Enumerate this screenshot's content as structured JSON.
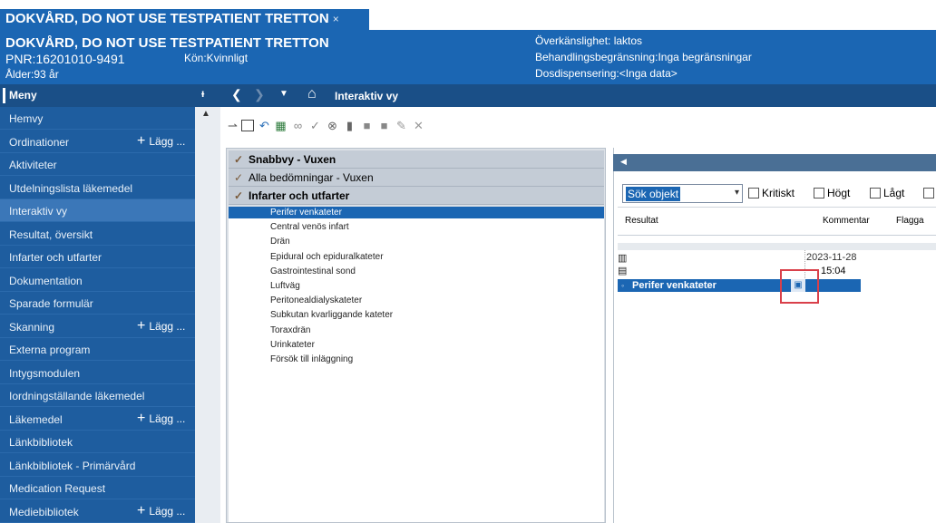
{
  "window": {
    "tab_title": "DOKVÅRD, DO NOT USE TESTPATIENT TRETTON",
    "tab_close": "×"
  },
  "patient": {
    "name": "DOKVÅRD, DO NOT USE TESTPATIENT TRETTON",
    "pnr": "PNR:16201010-9491",
    "sex": "Kön:Kvinnligt",
    "age": "Ålder:93 år",
    "alerts": [
      "Överkänslighet: laktos",
      "Behandlingsbegränsning:Inga begränsningar",
      "Dosdispensering:<Inga data>"
    ]
  },
  "menu": {
    "title": "Meny",
    "pin": "ᵻ",
    "items": [
      {
        "label": "Hemvy",
        "add": ""
      },
      {
        "label": "Ordinationer",
        "add": "Lägg ..."
      },
      {
        "label": "Aktiviteter",
        "add": ""
      },
      {
        "label": "Utdelningslista läkemedel",
        "add": ""
      },
      {
        "label": "Interaktiv vy",
        "add": "",
        "active": true
      },
      {
        "label": "Resultat, översikt",
        "add": ""
      },
      {
        "label": "Infarter och utfarter",
        "add": ""
      },
      {
        "label": "Dokumentation",
        "add": ""
      },
      {
        "label": "Sparade formulär",
        "add": ""
      },
      {
        "label": "Skanning",
        "add": "Lägg ..."
      },
      {
        "label": "Externa program",
        "add": ""
      },
      {
        "label": "Intygsmodulen",
        "add": ""
      },
      {
        "label": "Iordningställande läkemedel",
        "add": ""
      },
      {
        "label": "Läkemedel",
        "add": "Lägg ..."
      },
      {
        "label": "Länkbibliotek",
        "add": ""
      },
      {
        "label": "Länkbibliotek - Primärvård",
        "add": ""
      },
      {
        "label": "Medication Request",
        "add": ""
      },
      {
        "label": "Mediebibliotek",
        "add": "Lägg ..."
      }
    ]
  },
  "nav": {
    "back": "❮",
    "forward": "❯",
    "dropdown": "▼",
    "home": "⌂",
    "title": "Interaktiv vy"
  },
  "toolbar_icons": [
    "link-icon",
    "grid-icon",
    "undo-icon",
    "table-icon",
    "glasses-icon",
    "check-icon",
    "cancel-icon",
    "trash-icon",
    "block-icon",
    "block2-icon",
    "sign-icon",
    "close-icon"
  ],
  "panel": {
    "categories": [
      {
        "label": "Snabbvy - Vuxen",
        "bold": true
      },
      {
        "label": "Alla bedömningar - Vuxen",
        "bold": false
      },
      {
        "label": "Infarter och utfarter",
        "bold": true
      }
    ],
    "items": [
      {
        "label": "Perifer venkateter",
        "selected": true
      },
      {
        "label": "Central venös infart"
      },
      {
        "label": "Drän"
      },
      {
        "label": "Epidural och epiduralkateter"
      },
      {
        "label": "Gastrointestinal sond"
      },
      {
        "label": "Luftväg"
      },
      {
        "label": "Peritonealdialyskateter"
      },
      {
        "label": "Subkutan kvarliggande kateter"
      },
      {
        "label": "Toraxdrän"
      },
      {
        "label": "Urinkateter"
      },
      {
        "label": "Försök till inläggning"
      }
    ]
  },
  "results": {
    "search_value": "Sök objekt",
    "filters": [
      "Kritiskt",
      "Högt",
      "Lågt"
    ],
    "columns": [
      "Resultat",
      "Kommentar",
      "Flagga"
    ],
    "date": "2023-11-28",
    "time": "15:04",
    "row_label": "Perifer venkateter"
  },
  "colors": {
    "banner_blue": "#1b66b3",
    "sidebar_blue": "#1e5d9f",
    "highlight_red": "#d9404a"
  }
}
